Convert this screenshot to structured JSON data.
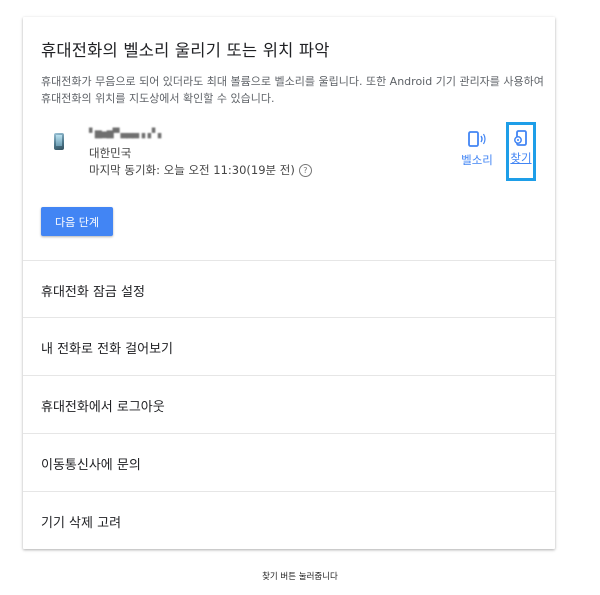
{
  "card": {
    "title": "휴대전화의 벨소리 울리기 또는 위치 파악",
    "description": "휴대전화가 무음으로 되어 있더라도 최대 볼륨으로 벨소리를 울립니다. 또한 Android 기기 관리자를 사용하여 휴대전화의 위치를 지도상에서 확인할 수 있습니다."
  },
  "device": {
    "icon": "phone-icon",
    "name": "▘▆▅▆▀ ▄▄▄▗▗ ▘▖",
    "country": "대한민국",
    "last_sync": "마지막 동기화: 오늘 오전 11:30(19분 전)",
    "help_glyph": "?"
  },
  "actions": {
    "ring_label": "벨소리",
    "find_label": "찾기",
    "highlight_color": "#1e9ee8",
    "accent_color": "#4285f4"
  },
  "next_button": {
    "label": "다음 단계"
  },
  "menu": [
    {
      "label": "휴대전화 잠금 설정"
    },
    {
      "label": "내 전화로 전화 걸어보기"
    },
    {
      "label": "휴대전화에서 로그아웃"
    },
    {
      "label": "이동통신사에 문의"
    },
    {
      "label": "기기 삭제 고려"
    }
  ],
  "caption": "찾기 버튼 눌러줍니다"
}
